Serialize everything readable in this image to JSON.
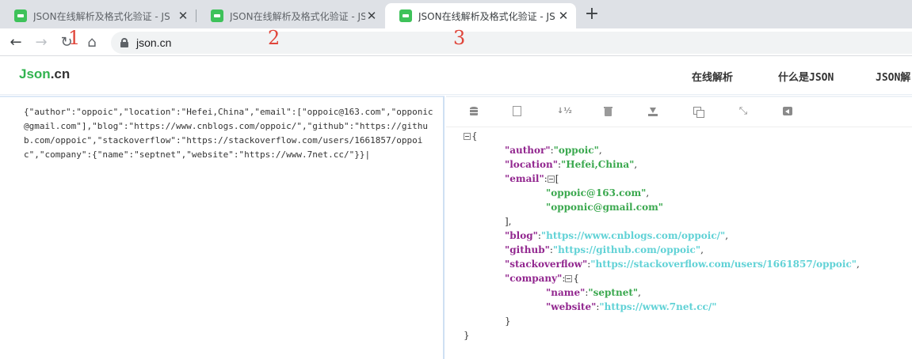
{
  "browser": {
    "tabs": [
      {
        "title": "JSON在线解析及格式化验证 - JS",
        "active": false
      },
      {
        "title": "JSON在线解析及格式化验证 - JS",
        "active": false
      },
      {
        "title": "JSON在线解析及格式化验证 - JS",
        "active": true
      }
    ],
    "new_tab": "+",
    "url": "json.cn"
  },
  "annotations": [
    "1",
    "2",
    "3"
  ],
  "site": {
    "logo_main": "Json",
    "logo_suffix": ".cn",
    "nav": [
      "在线解析",
      "什么是JSON",
      "JSON解"
    ]
  },
  "input_text": "{\"author\":\"oppoic\",\"location\":\"Hefei,China\",\"email\":[\"oppoic@163.com\",\"opponic@gmail.com\"],\"blog\":\"https://www.cnblogs.com/oppoic/\",\"github\":\"https://github.com/oppoic\",\"stackoverflow\":\"https://stackoverflow.com/users/1661857/oppoic\",\"company\":{\"name\":\"septnet\",\"website\":\"https://www.7net.cc/\"}}|",
  "toolbar_icons": [
    "database-icon",
    "document-icon",
    "sort-icon",
    "trash-icon",
    "download-icon",
    "copy-icon",
    "compress-icon",
    "share-icon"
  ],
  "tree": {
    "author": {
      "key": "\"author\"",
      "value": "\"oppoic\""
    },
    "location": {
      "key": "\"location\"",
      "value": "\"Hefei,China\""
    },
    "email": {
      "key": "\"email\"",
      "items": [
        "\"oppoic@163.com\"",
        "\"opponic@gmail.com\""
      ]
    },
    "blog": {
      "key": "\"blog\"",
      "value": "\"https://www.cnblogs.com/oppoic/\""
    },
    "github": {
      "key": "\"github\"",
      "value": "\"https://github.com/oppoic\""
    },
    "stackoverflow": {
      "key": "\"stackoverflow\"",
      "value": "\"https://stackoverflow.com/users/1661857/oppoic\""
    },
    "company": {
      "key": "\"company\"",
      "name": {
        "key": "\"name\"",
        "value": "\"septnet\""
      },
      "website": {
        "key": "\"website\"",
        "value": "\"https://www.7net.cc/\""
      }
    }
  },
  "colors": {
    "key": "#92278f",
    "string": "#3aa84e",
    "url": "#61d2d6",
    "brand": "#32b350",
    "annotation": "#e0453a"
  }
}
